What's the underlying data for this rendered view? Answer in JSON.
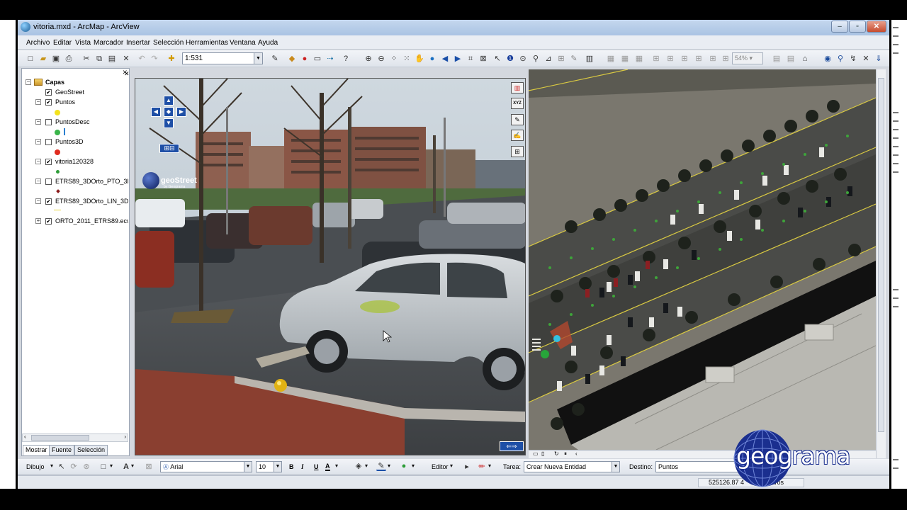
{
  "window": {
    "title": "vitoria.mxd - ArcMap - ArcView"
  },
  "menu": [
    "Archivo",
    "Editar",
    "Vista",
    "Marcador",
    "Insertar",
    "Selección",
    "Herramientas",
    "Ventana",
    "Ayuda"
  ],
  "toolbar": {
    "scale": "1:531",
    "zoom": "54%"
  },
  "toc": {
    "root": "Capas",
    "layers": [
      {
        "name": "GeoStreet",
        "checked": true
      },
      {
        "name": "Puntos",
        "checked": true
      },
      {
        "name": "PuntosDesc",
        "checked": false
      },
      {
        "name": "Puntos3D",
        "checked": false
      },
      {
        "name": "vitoria120328",
        "checked": true
      },
      {
        "name": "ETRS89_3DOrto_PTO_3D",
        "checked": false
      },
      {
        "name": "ETRS89_3DOrto_LIN_3D",
        "checked": true
      },
      {
        "name": "ORTO_2011_ETRS89.ecw",
        "checked": true
      }
    ],
    "tabs": [
      "Mostrar",
      "Fuente",
      "Selección"
    ]
  },
  "streetview": {
    "brand": "geoStreet",
    "brand_sub": "by Geograma"
  },
  "drawbar": {
    "dibujo": "Dibujo",
    "font": "Arial",
    "size": "10",
    "bold": "B",
    "italic": "I",
    "underline": "U",
    "font_color_glyph": "A",
    "editor": "Editor",
    "tarea_label": "Tarea:",
    "tarea_value": "Crear Nueva Entidad",
    "destino_label": "Destino:",
    "destino_value": "Puntos"
  },
  "status": {
    "coords": "525126.87  4",
    "units": "etros"
  },
  "logo": {
    "text": "geograma"
  },
  "colors": {
    "accent": "#1b2f8f",
    "titlebar": "#b7cce8",
    "layer_puntos": "#f3e21c",
    "layer_puntos3d": "#e02b1f",
    "layer_vitoria": "#2e9d38"
  }
}
